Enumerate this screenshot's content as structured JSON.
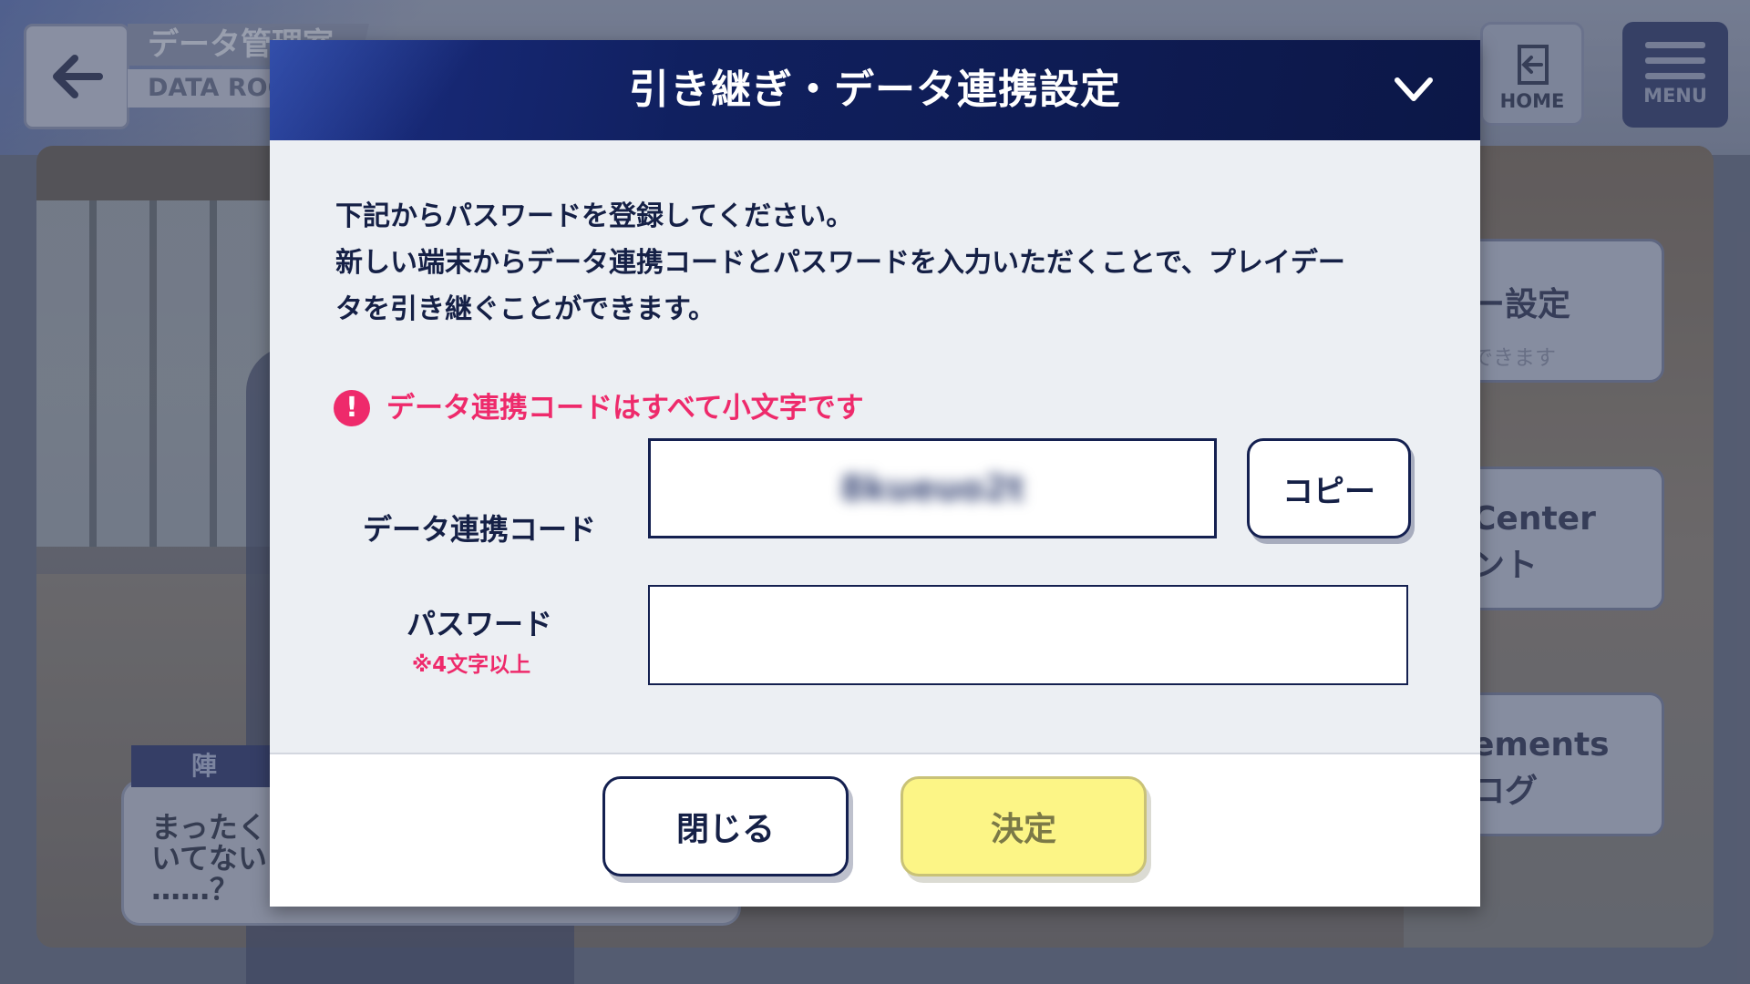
{
  "background": {
    "back_icon": "arrow-left-icon",
    "title_jp": "データ管理室",
    "title_en": "DATA ROOM",
    "home_label": "HOME",
    "home_icon": "exit-door-icon",
    "menu_label": "MENU",
    "menu_icon": "hamburger-icon",
    "side_cards": [
      {
        "line1": "ー設定",
        "sub": "できます"
      },
      {
        "line1": "Center",
        "line2": "ント"
      },
      {
        "line1": "ements",
        "line2": "ログ"
      }
    ],
    "chat": {
      "speaker": "陣",
      "lines": [
        "まったく",
        "いてない",
        "……？"
      ]
    }
  },
  "dialog": {
    "title": "引き継ぎ・データ連携設定",
    "collapse_icon": "chevron-down-icon",
    "description": [
      "下記からパスワードを登録してください。",
      "新しい端末からデータ連携コードとパスワードを入力いただくことで、プレイデー",
      "タを引き継ぐことができます。"
    ],
    "warning_icon": "exclamation-icon",
    "warning_text": "データ連携コードはすべて小文字です",
    "code_label": "データ連携コード",
    "code_value": "8kueuo2t",
    "copy_label": "コピー",
    "password_label": "パスワード",
    "password_hint": "※4文字以上",
    "password_value": "",
    "close_label": "閉じる",
    "confirm_label": "決定"
  },
  "colors": {
    "header_navy": "#10205f",
    "accent_pink": "#ee2a6b",
    "confirm_yellow": "#fcf586",
    "text_navy": "#152046"
  }
}
